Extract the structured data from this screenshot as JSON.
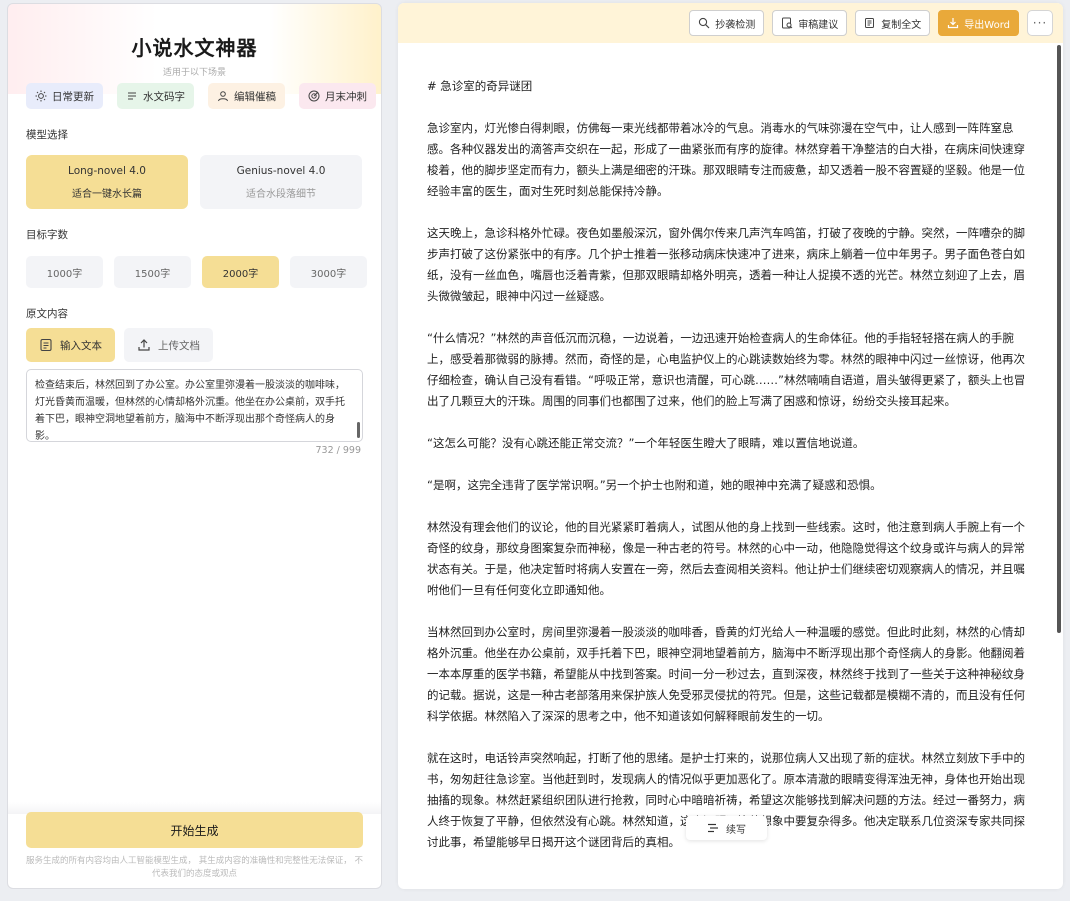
{
  "app": {
    "title": "小说水文神器",
    "subtitle": "适用于以下场景"
  },
  "scenes": [
    {
      "label": "日常更新",
      "icon": "sun-icon"
    },
    {
      "label": "水文码字",
      "icon": "list-icon"
    },
    {
      "label": "编辑催稿",
      "icon": "person-icon"
    },
    {
      "label": "月末冲刺",
      "icon": "target-icon"
    }
  ],
  "model_section": {
    "label": "模型选择"
  },
  "models": [
    {
      "name": "Long-novel 4.0",
      "desc": "适合一键水长篇",
      "selected": true
    },
    {
      "name": "Genius-novel 4.0",
      "desc": "适合水段落细节",
      "selected": false
    }
  ],
  "word_count_section": {
    "label": "目标字数"
  },
  "word_counts": [
    {
      "label": "1000字",
      "selected": false
    },
    {
      "label": "1500字",
      "selected": false
    },
    {
      "label": "2000字",
      "selected": true
    },
    {
      "label": "3000字",
      "selected": false
    }
  ],
  "source_section": {
    "label": "原文内容"
  },
  "source_tabs": [
    {
      "label": "输入文本",
      "icon": "document-icon",
      "selected": true
    },
    {
      "label": "上传文档",
      "icon": "upload-icon",
      "selected": false
    }
  ],
  "source_text": "检查结束后，林然回到了办公室。办公室里弥漫着一股淡淡的咖啡味，灯光昏黄而温暖，但林然的心情却格外沉重。他坐在办公桌前，双手托着下巴，眼神空洞地望着前方，脑海中不断浮现出那个奇怪病人的身影。",
  "char_count": "732 / 999",
  "generate_label": "开始生成",
  "disclaimer": "服务生成的所有内容均由人工智能模型生成， 其生成内容的准确性和完整性无法保证， 不代表我们的态度或观点",
  "toolbar": {
    "plagiarism": "抄袭检测",
    "review": "审稿建议",
    "copy_all": "复制全文",
    "export_word": "导出Word"
  },
  "document": {
    "heading": "# 急诊室的奇异谜团",
    "paragraphs": [
      "急诊室内，灯光惨白得刺眼，仿佛每一束光线都带着冰冷的气息。消毒水的气味弥漫在空气中，让人感到一阵阵窒息感。各种仪器发出的滴答声交织在一起，形成了一曲紧张而有序的旋律。林然穿着干净整洁的白大褂，在病床间快速穿梭着，他的脚步坚定而有力，额头上满是细密的汗珠。那双眼睛专注而疲惫，却又透着一股不容置疑的坚毅。他是一位经验丰富的医生，面对生死时刻总能保持冷静。",
      "这天晚上，急诊科格外忙碌。夜色如墨般深沉，窗外偶尔传来几声汽车鸣笛，打破了夜晚的宁静。突然，一阵嘈杂的脚步声打破了这份紧张中的有序。几个护士推着一张移动病床快速冲了进来，病床上躺着一位中年男子。男子面色苍白如纸，没有一丝血色，嘴唇也泛着青紫，但那双眼睛却格外明亮，透着一种让人捉摸不透的光芒。林然立刻迎了上去，眉头微微皱起，眼神中闪过一丝疑惑。",
      "“什么情况？”林然的声音低沉而沉稳，一边说着，一边迅速开始检查病人的生命体征。他的手指轻轻搭在病人的手腕上，感受着那微弱的脉搏。然而，奇怪的是，心电监护仪上的心跳读数始终为零。林然的眼神中闪过一丝惊讶，他再次仔细检查，确认自己没有看错。“呼吸正常，意识也清醒，可心跳……”林然喃喃自语道，眉头皱得更紧了，额头上也冒出了几颗豆大的汗珠。周围的同事们也都围了过来，他们的脸上写满了困惑和惊讶，纷纷交头接耳起来。",
      "“这怎么可能？没有心跳还能正常交流？”一个年轻医生瞪大了眼睛，难以置信地说道。",
      "“是啊，这完全违背了医学常识啊。”另一个护士也附和道，她的眼神中充满了疑惑和恐惧。",
      "林然没有理会他们的议论，他的目光紧紧盯着病人，试图从他的身上找到一些线索。这时，他注意到病人手腕上有一个奇怪的纹身，那纹身图案复杂而神秘，像是一种古老的符号。林然的心中一动，他隐隐觉得这个纹身或许与病人的异常状态有关。于是，他决定暂时将病人安置在一旁，然后去查阅相关资料。他让护士们继续密切观察病人的情况，并且嘱咐他们一旦有任何变化立即通知他。",
      "当林然回到办公室时，房间里弥漫着一股淡淡的咖啡香，昏黄的灯光给人一种温暖的感觉。但此时此刻，林然的心情却格外沉重。他坐在办公桌前，双手托着下巴，眼神空洞地望着前方，脑海中不断浮现出那个奇怪病人的身影。他翻阅着一本本厚重的医学书籍，希望能从中找到答案。时间一分一秒过去，直到深夜，林然终于找到了一些关于这种神秘纹身的记载。据说，这是一种古老部落用来保护族人免受邪灵侵扰的符咒。但是，这些记载都是模糊不清的，而且没有任何科学依据。林然陷入了深深的思考之中，他不知道该如何解释眼前发生的一切。",
      "就在这时，电话铃声突然响起，打断了他的思绪。是护士打来的，说那位病人又出现了新的症状。林然立刻放下手中的书，匆匆赶往急诊室。当他赶到时，发现病人的情况似乎更加恶化了。原本清澈的眼睛变得浑浊无神，身体也开始出现抽搐的现象。林然赶紧组织团队进行抢救，同时心中暗暗祈祷，希望这次能够找到解决问题的方法。经过一番努力，病人终于恢复了平静，但依然没有心跳。林然知道，这个问题远比他想象中要复杂得多。他决定联系几位资深专家共同探讨此事，希望能够早日揭开这个谜团背后的真相。"
    ]
  },
  "continue_label": "续写"
}
